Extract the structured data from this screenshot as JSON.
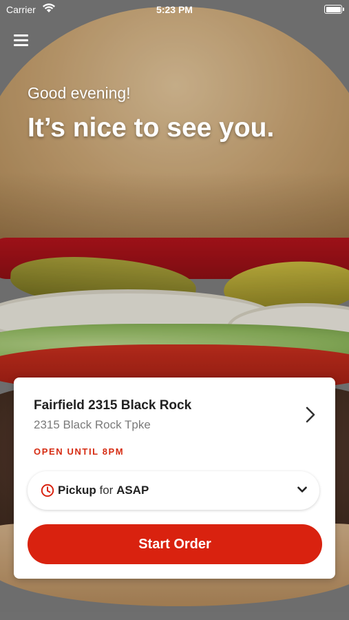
{
  "status_bar": {
    "carrier": "Carrier",
    "time": "5:23 PM"
  },
  "header": {
    "menu_icon": "hamburger-menu-icon",
    "greeting": "Good evening!",
    "headline": "It’s nice to see you."
  },
  "store_card": {
    "name": "Fairfield 2315 Black Rock",
    "address": "2315 Black Rock Tpke",
    "open_status": "OPEN UNTIL 8PM",
    "order_mode": {
      "method": "Pickup",
      "connector": "for",
      "time": "ASAP"
    },
    "start_order_label": "Start Order"
  },
  "colors": {
    "accent": "#d9220f",
    "status_text": "#d62c12"
  }
}
